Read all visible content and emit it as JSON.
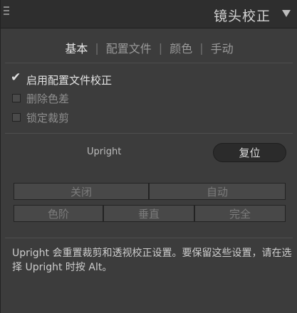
{
  "header": {
    "title": "镜头校正"
  },
  "tabs": [
    {
      "label": "基本",
      "active": true
    },
    {
      "label": "配置文件",
      "active": false
    },
    {
      "label": "颜色",
      "active": false
    },
    {
      "label": "手动",
      "active": false
    }
  ],
  "options": {
    "enable_profile": {
      "label": "启用配置文件校正",
      "checked": true
    },
    "remove_ca": {
      "label": "删除色差",
      "checked": false
    },
    "constrain_crop": {
      "label": "锁定裁剪",
      "checked": false
    }
  },
  "upright": {
    "label": "Upright",
    "reset_label": "复位",
    "row1": [
      "关闭",
      "自动"
    ],
    "row2": [
      "色阶",
      "垂直",
      "完全"
    ]
  },
  "description": "Upright 会重置裁剪和透视校正设置。要保留这些设置，请在选择 Upright 时按 Alt。"
}
